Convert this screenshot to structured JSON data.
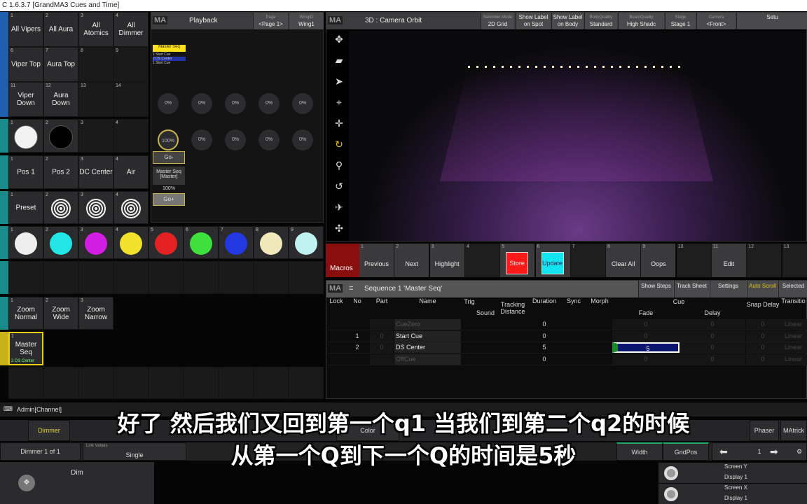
{
  "window_title": "C 1.6.3.7 [GrandMA3 Cues and Time]",
  "groups": [
    {
      "n": "1",
      "label": "All Vipers"
    },
    {
      "n": "2",
      "label": "All Aura"
    },
    {
      "n": "3",
      "label": "All Atomics"
    },
    {
      "n": "4",
      "label": "All Dimmer"
    },
    {
      "n": "6",
      "label": "Viper Top"
    },
    {
      "n": "7",
      "label": "Aura Top"
    },
    {
      "n": "8",
      "label": ""
    },
    {
      "n": "9",
      "label": ""
    },
    {
      "n": "11",
      "label": "Viper Down"
    },
    {
      "n": "12",
      "label": "Aura Down"
    },
    {
      "n": "13",
      "label": ""
    },
    {
      "n": "14",
      "label": ""
    }
  ],
  "dimmer_presets": [
    {
      "n": "1",
      "color": "#f2f2f2"
    },
    {
      "n": "2",
      "color": "#000000"
    },
    {
      "n": "3"
    },
    {
      "n": "4"
    }
  ],
  "position_presets": [
    {
      "n": "1",
      "label": "Pos 1"
    },
    {
      "n": "2",
      "label": "Pos 2"
    },
    {
      "n": "3",
      "label": "DC Center"
    },
    {
      "n": "4",
      "label": "Air"
    }
  ],
  "gobo_presets": [
    {
      "n": "1",
      "label": "Preset"
    },
    {
      "n": "2",
      "label": ""
    },
    {
      "n": "3",
      "label": ""
    },
    {
      "n": "4",
      "label": ""
    }
  ],
  "color_presets": [
    {
      "n": "1",
      "color": "#eeeeee"
    },
    {
      "n": "2",
      "color": "#22e5e5"
    },
    {
      "n": "3",
      "color": "#d21ee0"
    },
    {
      "n": "4",
      "color": "#f2e12a"
    },
    {
      "n": "5",
      "color": "#e52222"
    },
    {
      "n": "6",
      "color": "#3ee03e"
    },
    {
      "n": "7",
      "color": "#2238e0"
    },
    {
      "n": "8",
      "color": "#efe8b8"
    },
    {
      "n": "9",
      "color": "#bff2f0"
    }
  ],
  "beam_presets": [
    {
      "n": "1",
      "label": "Zoom Normal"
    },
    {
      "n": "2",
      "label": "Zoom Wide"
    },
    {
      "n": "3",
      "label": "Zoom Narrow"
    }
  ],
  "sequence_pool": [
    {
      "n": "1",
      "label": "Master Seq",
      "status": "2 DS Center"
    }
  ],
  "playback": {
    "title": "Playback",
    "page_label": "Page",
    "page": "<Page 1>",
    "wing_label": "WingID",
    "wing": "Wing1",
    "master_label": "Master Seq",
    "cue_lines": [
      "1 Start Cue",
      "2 DS Center",
      "1 Start Cue"
    ],
    "row1_knobs": [
      "0%",
      "0%",
      "0%",
      "0%",
      "0%"
    ],
    "row2_knobs": [
      "100%",
      "0%",
      "0%",
      "0%",
      "0%"
    ],
    "go_minus": "Go-",
    "seq_name": "Master Seq [Master]",
    "fader": "100%",
    "go_plus": "Go+"
  },
  "viewer": {
    "title": "3D : Camera Orbit",
    "buttons": [
      {
        "small": "Selection Mode",
        "label": "2D Grid"
      },
      {
        "small": "",
        "label": "Show Label on Spot"
      },
      {
        "small": "",
        "label": "Show Label on Body"
      },
      {
        "small": "BodyQuality",
        "label": "Standard"
      },
      {
        "small": "BeamQuality",
        "label": "High Shadc"
      },
      {
        "small": "Stage",
        "label": "Stage 1"
      },
      {
        "small": "Camera",
        "label": "<Front>"
      },
      {
        "small": "",
        "label": "Setu"
      }
    ],
    "tools": [
      "move-icon",
      "camera-icon",
      "pointer-icon",
      "target-icon",
      "pan-icon",
      "orbit-icon",
      "zoom-icon",
      "rotate-icon",
      "fly-icon",
      "fit-icon"
    ]
  },
  "macros": {
    "title": "Macros",
    "items": [
      {
        "n": "1",
        "label": "Previous"
      },
      {
        "n": "2",
        "label": "Next"
      },
      {
        "n": "3",
        "label": "Highlight"
      },
      {
        "n": "4",
        "label": ""
      },
      {
        "n": "5",
        "label": "Store",
        "color": "#ff1a1a"
      },
      {
        "n": "6",
        "label": "Update",
        "color": "#12e5f0"
      },
      {
        "n": "7",
        "label": ""
      },
      {
        "n": "8",
        "label": "Clear All"
      },
      {
        "n": "9",
        "label": "Oops"
      },
      {
        "n": "10",
        "label": ""
      },
      {
        "n": "11",
        "label": "Edit"
      },
      {
        "n": "12",
        "label": ""
      },
      {
        "n": "13",
        "label": ""
      }
    ]
  },
  "sequence": {
    "title": "Sequence 1 'Master Seq'",
    "buttons": [
      "Show Steps",
      "Track Sheet",
      "Settings",
      "Auto Scroll",
      "Selected"
    ],
    "columns": {
      "lock": "Lock",
      "no": "No",
      "part": "Part",
      "name": "Name",
      "trig": "Trig",
      "sound": "Sound",
      "tracking": "Tracking Distance",
      "duration": "Duration",
      "sync": "Sync",
      "morph": "Morph",
      "cue": "Cue",
      "fade": "Fade",
      "delay": "Delay",
      "snap": "Snap Delay",
      "transition": "Transitio"
    },
    "rows": [
      {
        "no": "",
        "part": "",
        "name": "CueZero",
        "duration": "0",
        "fade": "0",
        "delay": "0",
        "snap": "0",
        "transition": "Linear"
      },
      {
        "no": "1",
        "part": "0",
        "name": "Start  Cue",
        "duration": "0",
        "fade": "0",
        "delay": "0",
        "snap": "0",
        "transition": "Linear"
      },
      {
        "no": "2",
        "part": "0",
        "name": "DS  Center",
        "duration": "5",
        "fade": "5",
        "delay": "0",
        "snap": "0",
        "transition": "Linear"
      },
      {
        "no": "",
        "part": "",
        "name": "OffCue",
        "duration": "0",
        "fade": "0",
        "delay": "0",
        "snap": "0",
        "transition": "Linear"
      }
    ]
  },
  "command_line": "Admin[Channel]",
  "preset_tabs": [
    "Dimmer",
    "Color",
    "Phaser",
    "MAtrick"
  ],
  "encoder_bar": {
    "selection": "Dimmer 1 of 1",
    "link_label": "Link Values",
    "link": "Single",
    "width": "Width",
    "gridpos": "GridPos",
    "page": "1"
  },
  "encoder": {
    "label": "Dim"
  },
  "screen_encoders": [
    {
      "label": "Screen Y",
      "sub": "Display 1"
    },
    {
      "label": "Screen X",
      "sub": "Display 1"
    }
  ],
  "subtitles": [
    "好了 然后我们又回到第一个q1 当我们到第二个q2的时候",
    "从第一个Q到下一个Q的时间是5秒"
  ]
}
